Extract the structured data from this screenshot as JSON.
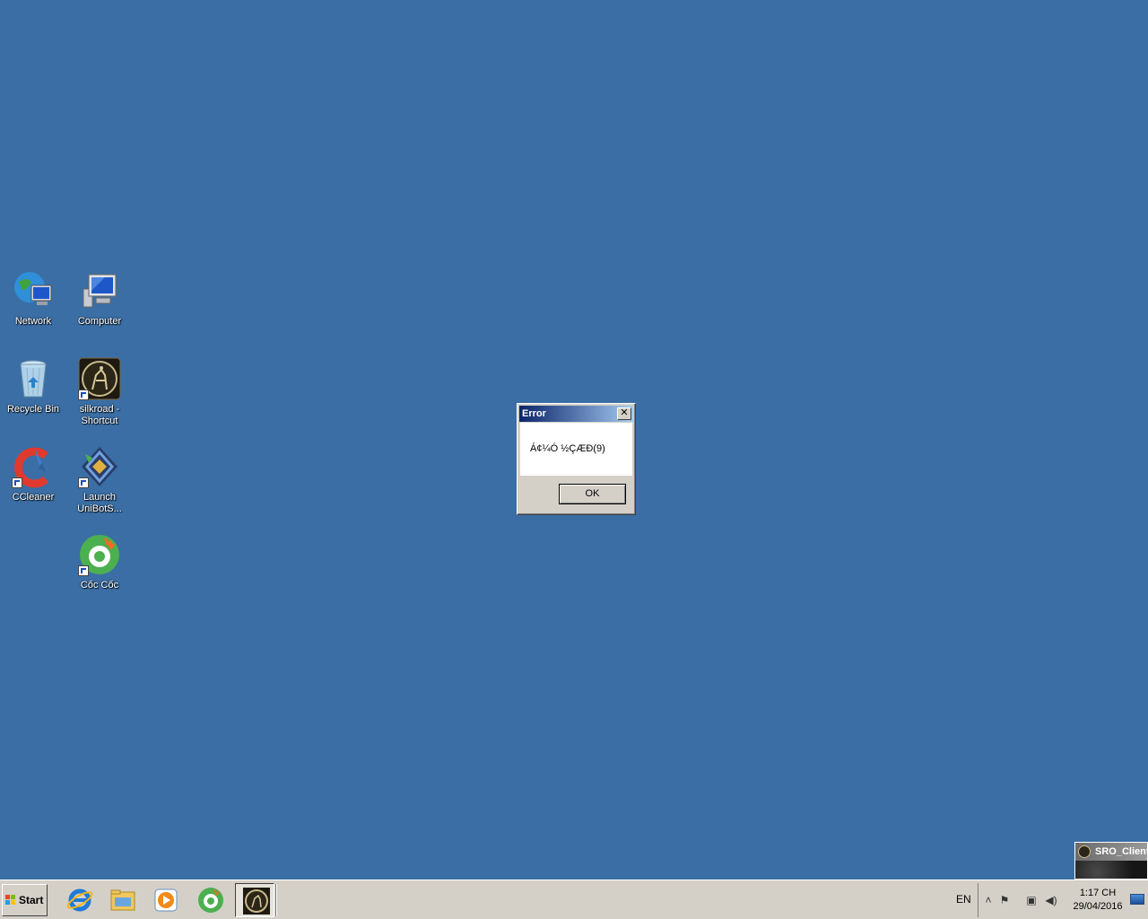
{
  "desktop": {
    "icons": [
      {
        "label": "Network"
      },
      {
        "label": "Computer"
      },
      {
        "label": "Recycle Bin"
      },
      {
        "label": "silkroad - Shortcut"
      },
      {
        "label": "CCleaner"
      },
      {
        "label": "Launch UniBotS..."
      },
      {
        "label": "Cốc Cốc"
      }
    ]
  },
  "dialog": {
    "title": "Error",
    "message": "Á¢¼Ó ½ÇÆÐ(9)",
    "ok_label": "OK",
    "close_glyph": "✕"
  },
  "thumbnail": {
    "title": "SRO_Client"
  },
  "taskbar": {
    "start_label": "Start",
    "pinned": [
      "internet-explorer-icon",
      "windows-explorer-icon",
      "media-player-icon",
      "coccoc-icon",
      "silkroad-icon"
    ],
    "language": "EN",
    "clock_time": "1:17 CH",
    "clock_date": "29/04/2016"
  },
  "colors": {
    "desktop": "#3a6ea5",
    "taskbar": "#d4d0c8",
    "titlebar_start": "#0a246a",
    "titlebar_end": "#a6caf0"
  }
}
